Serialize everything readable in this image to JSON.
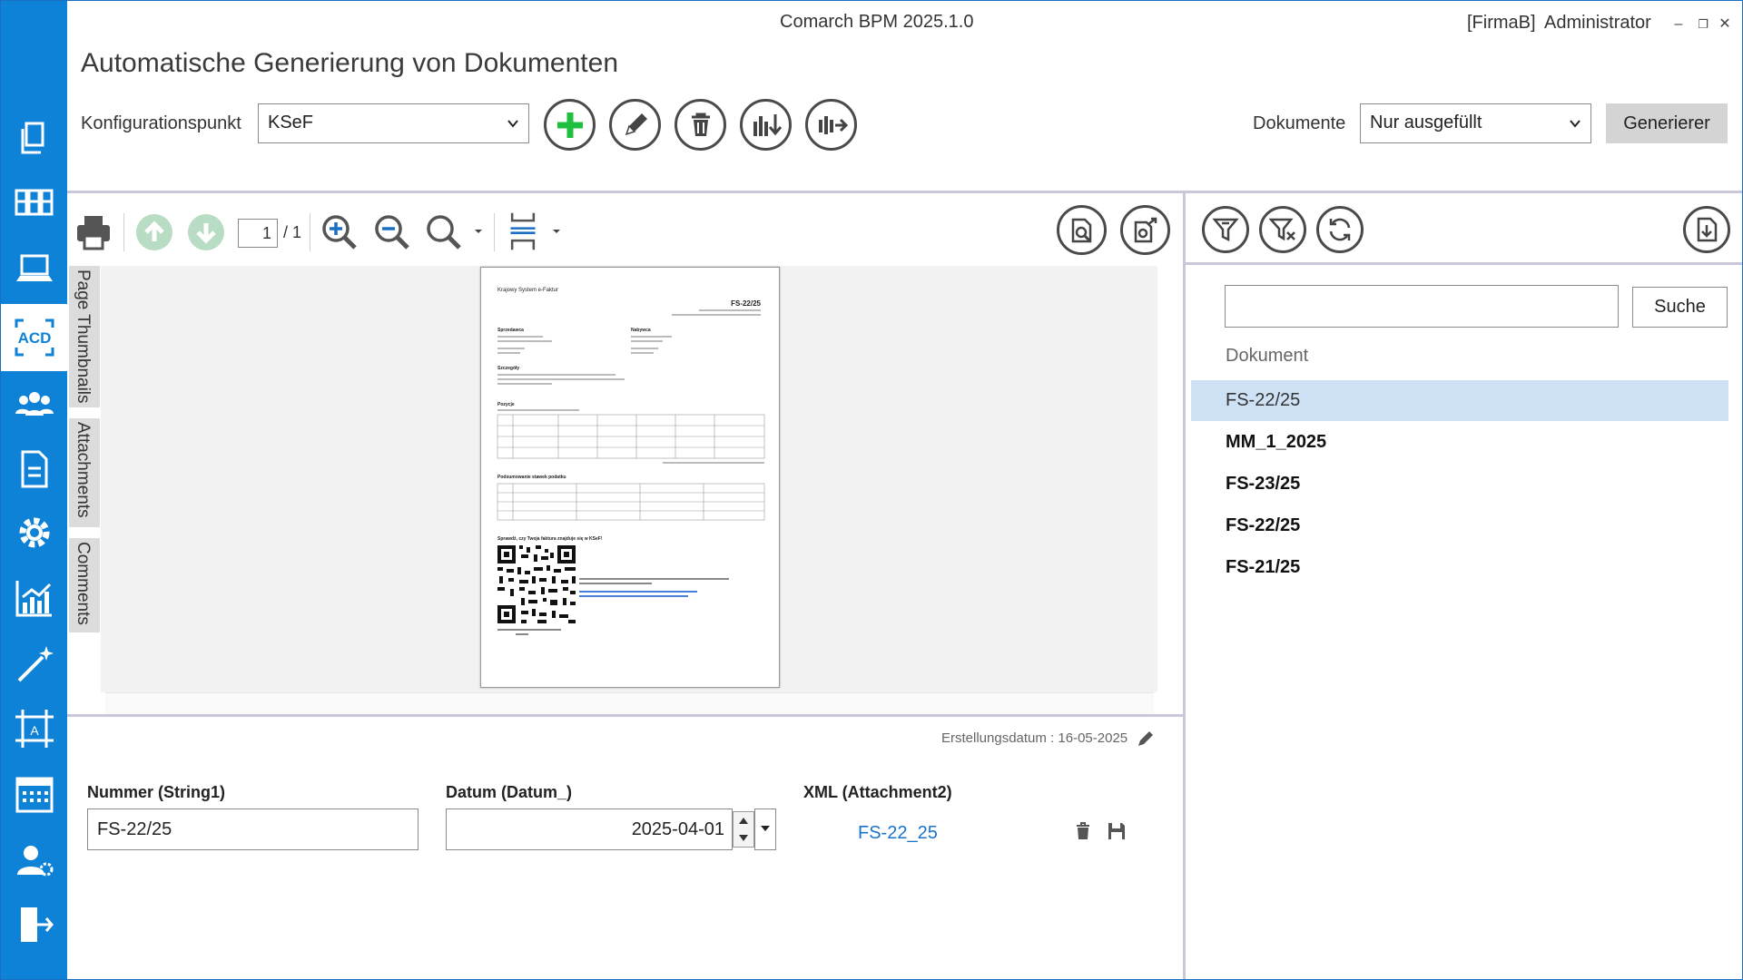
{
  "window": {
    "app_title": "Comarch BPM 2025.1.0",
    "company": "[FirmaB]",
    "user": "Administrator"
  },
  "page": {
    "title": "Automatische Generierung von Dokumenten"
  },
  "toolbar": {
    "config_label": "Konfigurationspunkt",
    "config_value": "KSeF",
    "documents_label": "Dokumente",
    "documents_value": "Nur ausgefüllt",
    "generate_label": "Generierer"
  },
  "viewer": {
    "page_current": "1",
    "page_total": "/ 1",
    "side_tabs": [
      "Page Thumbnails",
      "Attachments",
      "Comments"
    ]
  },
  "preview_doc": {
    "brand": "Krajowy System e-Faktur",
    "number": "FS-22/25",
    "seller_heading": "Sprzedawca",
    "buyer_heading": "Nabywca",
    "details_heading": "Szczegóły",
    "positions_heading": "Pozycje",
    "summary_heading": "Podsumowanie stawek podatku",
    "verify_heading": "Sprawdź, czy Twoja faktura znajduje się w KSeF!"
  },
  "right_panel": {
    "search_value": "",
    "search_button": "Suche",
    "column_header": "Dokument",
    "documents": [
      {
        "name": "FS-22/25",
        "selected": true,
        "bold": false
      },
      {
        "name": "MM_1_2025",
        "selected": false,
        "bold": true
      },
      {
        "name": "FS-23/25",
        "selected": false,
        "bold": true
      },
      {
        "name": "FS-22/25",
        "selected": false,
        "bold": true
      },
      {
        "name": "FS-21/25",
        "selected": false,
        "bold": true
      }
    ]
  },
  "form": {
    "created_date": "Erstellungsdatum : 16-05-2025",
    "number_label": "Nummer (String1)",
    "number_value": "FS-22/25",
    "date_label": "Datum (Datum_)",
    "date_value": "2025-04-01",
    "xml_label": "XML (Attachment2)",
    "xml_value": "FS-22_25"
  },
  "colors": {
    "sidebar": "#0e82d6",
    "accent_green": "#1fbf3f",
    "selection": "#cfe2f5",
    "link": "#1a73c8"
  },
  "icons": {
    "sidebar": [
      "documents-icon",
      "kanban-icon",
      "laptop-icon",
      "acd-icon",
      "users-icon",
      "workflow-document-icon",
      "gear-icon",
      "chart-icon",
      "magic-wand-icon",
      "ocr-frame-icon",
      "calendar-icon",
      "user-settings-icon",
      "logout-icon"
    ]
  }
}
